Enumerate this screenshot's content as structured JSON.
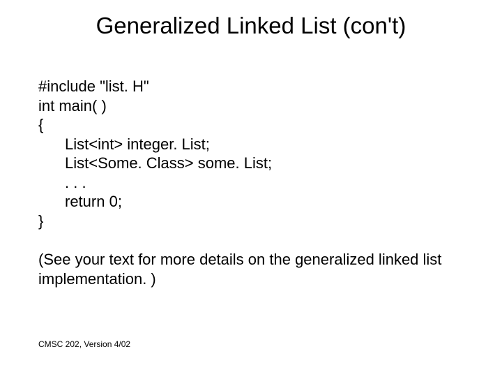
{
  "title": "Generalized Linked List (con't)",
  "code": {
    "l1": "#include \"list. H\"",
    "l2": "int main( )",
    "l3": "{",
    "l4": "List<int> integer. List;",
    "l5": "List<Some. Class> some. List;",
    "l6": ". . .",
    "l7": "return 0;",
    "l8": "}"
  },
  "note": "(See your text for more details on the generalized linked list implementation. )",
  "footer": "CMSC 202, Version 4/02"
}
